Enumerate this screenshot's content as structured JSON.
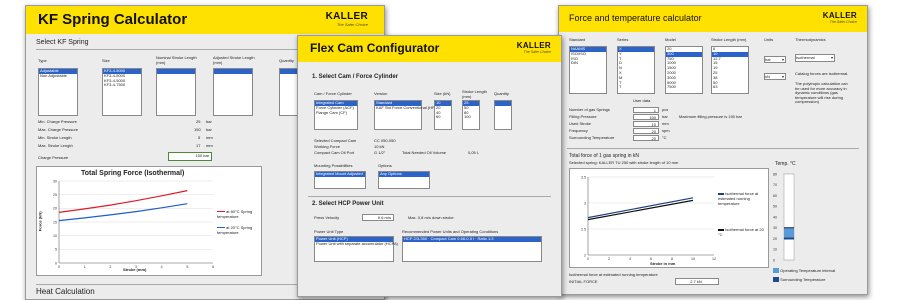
{
  "brand": {
    "name": "KALLER",
    "tagline": "The Safer Choice",
    "accent": "#ffe100"
  },
  "kf": {
    "title": "KF Spring Calculator",
    "section": "Select KF Spring",
    "col_type": "Type",
    "col_size": "Size",
    "col_nominal": "Nominal Stroke Length (mm)",
    "col_adjusted": "Adjusted Stroke Length (mm)",
    "col_quantity": "Quantity",
    "types": [
      "Adjustable",
      "Non Adjustable"
    ],
    "sizes": [
      "KF3-4-5000",
      "KF3-4-5000",
      "KF3-4-5000",
      "KF3-4-7500"
    ],
    "results": [
      {
        "label": "Min. Charge Pressure",
        "value": "25",
        "unit": "bar"
      },
      {
        "label": "Max. Charge Pressure",
        "value": "150",
        "unit": "bar"
      },
      {
        "label": "Min. Stroke Length",
        "value": "5",
        "unit": "mm"
      },
      {
        "label": "Max. Stroke Length",
        "value": "17",
        "unit": "mm"
      }
    ],
    "charge_label": "Charge Pressure",
    "charge_value": "150",
    "charge_unit": "bar",
    "chart_title": "Total Spring Force (Isothermal)",
    "y_label": "Force (kN)",
    "x_label": "Stroke (mm)",
    "legend_80": "at 80°C Spring temperature",
    "legend_20": "at 20°C Spring temperature",
    "heat_title": "Heat Calculation",
    "chart_data": {
      "type": "line",
      "x_label": "Stroke (mm)",
      "y_label": "Force (kN)",
      "xlim": [
        0,
        6
      ],
      "ylim": [
        0,
        30
      ],
      "series": [
        {
          "name": "at 80°C Spring temperature",
          "color": "#d81e2a",
          "x": [
            0,
            1,
            2,
            3,
            4,
            5
          ],
          "y": [
            18.5,
            19.8,
            21.2,
            22.8,
            24.6,
            26.5
          ]
        },
        {
          "name": "at 20°C Spring temperature",
          "color": "#1e5ec9",
          "x": [
            0,
            1,
            2,
            3,
            4,
            5
          ],
          "y": [
            15.5,
            16.5,
            17.6,
            18.8,
            20.2,
            21.7
          ]
        }
      ],
      "x_ticks": [
        "0",
        "1",
        "2",
        "3",
        "4",
        "5",
        "6"
      ],
      "y_ticks": [
        "0",
        "5",
        "10",
        "15",
        "20",
        "25",
        "30"
      ]
    }
  },
  "fc": {
    "title": "Flex Cam Configurator",
    "sec1": "1. Select Cam / Force Cylinder",
    "col_force": "Cam / Force Cylinder",
    "col_version": "Version",
    "col_size": "Size (kN)",
    "col_stroke": "Stroke Length (mm)",
    "col_qty": "Quantity",
    "force_items": [
      "Integrated Cam",
      "Force Cylinder (ACF)",
      "Flange Cam (CF)"
    ],
    "version_items": [
      "Standard",
      "KAF Std Force Conventional (HP)"
    ],
    "size_items": [
      "10",
      "20",
      "40",
      "60"
    ],
    "stroke_items": [
      "25",
      "50",
      "80",
      "100"
    ],
    "info_rows": [
      {
        "label": "Selected Compact Cam",
        "value": "CC 050-050"
      },
      {
        "label": "Working Force",
        "value": "10 kN"
      },
      {
        "label": "Compact Cam Oil Port",
        "value": "G 1/2\""
      }
    ],
    "needed_oil_label": "Total Needed Oil Volume",
    "needed_oil_value": "0,05 L",
    "mount_label": "Mounting Possibilities",
    "mount_value": "Integrated Mount Adjusted",
    "options_label": "Options",
    "options_value": "Any Options",
    "sec2": "2. Select HCP Power Unit",
    "press_velocity_label": "Press Velocity",
    "press_velocity_value": "0.6",
    "press_velocity_unit": "m/s",
    "press_velocity_note": "Max. 0,8 m/s down stroke",
    "pu_type_label": "Power Unit Type",
    "pu_config_label": "Recommended Power Units and Operating Conditions",
    "pu_types": [
      "Power Unit (HCP)",
      "Power Unit with separate accumulator (HCPA)"
    ],
    "pu_configs": [
      "HCP 2/3-350 · Compact Cam 0.66-0.5 l · Ratio 1:3"
    ]
  },
  "ft": {
    "title": "Force and temperature calculator",
    "col_standard": "Standard",
    "col_series": "Series",
    "col_model": "Model",
    "col_stroke": "Stroke Length (mm)",
    "col_units": "Units",
    "col_thermo": "Thermodynamics",
    "standards": [
      "NAAMS",
      "ISO/ISO",
      "ISO",
      "DIN"
    ],
    "series": [
      "X",
      "Y",
      "T",
      "D",
      "N",
      "X",
      "M",
      "T",
      "T",
      "KU",
      "BLB"
    ],
    "models": [
      "20",
      "300",
      "750",
      "1000",
      "1500",
      "2000",
      "3000",
      "5000",
      "7500",
      "10000"
    ],
    "strokes": [
      "6",
      "10",
      "12.7",
      "15",
      "19",
      "25",
      "38",
      "50",
      "63",
      "80"
    ],
    "unit_value": "bar",
    "unit_value2": "kN",
    "thermo_value": "Isothermal",
    "thermo_note": "Catalog forces are isothermal.",
    "thermo_note2": "The polytropic calculation can be used for more accuracy in dynamic conditions (gas temperature will rise during compression)",
    "user_data_label": "User data",
    "user_rows": [
      {
        "label": "Number of gas Springs",
        "value": "1",
        "unit": "pcs"
      },
      {
        "label": "Filling Pressure",
        "value": "150",
        "unit": "bar"
      },
      {
        "label": "Used Stroke",
        "value": "10",
        "unit": "mm"
      },
      {
        "label": "Frequency",
        "value": "20",
        "unit": "spm"
      },
      {
        "label": "Surrounding Temperature",
        "value": "20",
        "unit": "°C"
      }
    ],
    "max_pressure_note": "Maximum filling pressure is 150 bar",
    "chart_title": "Total force of 1 gas spring in kN",
    "chart_subtitle": "Selected spring: KALLER TU 250 with stroke length of 10 mm",
    "x_label": "Stroke in mm",
    "legend_iso": "Isothermal force at estimated running temperature",
    "legend_20": "Isothermal force at 20 °C",
    "temp_title": "Temp. °C",
    "temp_legend_interval": "Operating Temperature interval",
    "temp_legend_surround": "Surrounding Temperature",
    "iso_label": "Isothermal force at estimated running temperature",
    "initial_force_label": "INITIAL FORCE",
    "initial_force_value": "2.7 kN",
    "chart_data": {
      "type": "line",
      "x_label": "Stroke in mm",
      "xlim": [
        0,
        12
      ],
      "ylim": [
        2,
        3.5
      ],
      "series": [
        {
          "name": "Isothermal force at estimated running temperature",
          "color": "#1e3f7a",
          "x": [
            0,
            10
          ],
          "y": [
            2.72,
            3.1
          ]
        },
        {
          "name": "Isothermal force at 20 °C",
          "color": "#111111",
          "x": [
            0,
            10
          ],
          "y": [
            2.68,
            3.05
          ]
        }
      ],
      "x_ticks": [
        "0",
        "2",
        "4",
        "6",
        "8",
        "10",
        "12"
      ],
      "y_ticks": [
        "2",
        "2.5",
        "3",
        "3.5"
      ],
      "temp_ticks": [
        "80",
        "70",
        "60",
        "50",
        "40",
        "30",
        "20",
        "10",
        "0"
      ]
    }
  }
}
